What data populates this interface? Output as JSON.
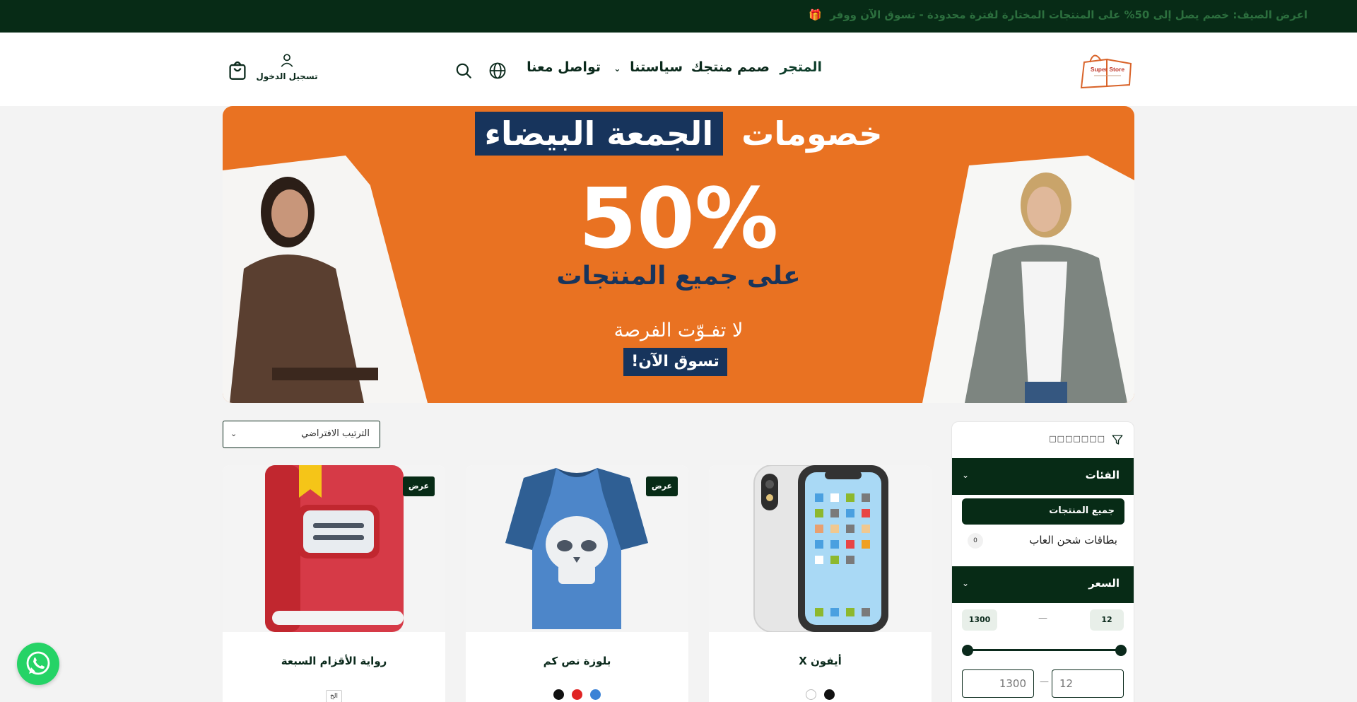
{
  "promo_bar": {
    "text": "اعرض الصيف: خصم يصل إلى 50% على المنتجات المختارة لفترة محدودة - تسوق الآن ووفر",
    "gift_icon": "🎁"
  },
  "header": {
    "logo_text": "Super Store",
    "nav": {
      "store": "المتجر",
      "design": "صمم منتجك",
      "policies": "سياستنا",
      "contact": "تواصل معنا"
    },
    "account_label": "تسجيل الدخول",
    "icons": [
      "globe-icon",
      "search-icon",
      "user-icon",
      "shopping-bag-icon"
    ]
  },
  "banner": {
    "title_plain": "خصومات",
    "title_highlight": "الجمعة البيضاء",
    "percent": "50%",
    "subtitle": "على جميع المنتجات",
    "dont_miss": "لا تفـوّت الفرصة",
    "cta": "تسوق الآن!"
  },
  "sort": {
    "selected": "الترتيب الافتراضي"
  },
  "filters": {
    "title": "□□□□□□□",
    "categories_title": "الفئات",
    "all_products": "جميع المنتجات",
    "category_items": [
      {
        "name": "بطاقات شحن العاب",
        "count": "0"
      }
    ],
    "price_title": "السعر",
    "price_min": "12",
    "price_max": "1300",
    "dash": "—"
  },
  "products": [
    {
      "name": "أيفون X",
      "badge": "",
      "colors": [
        "#111111",
        "#ffffff"
      ],
      "size": ""
    },
    {
      "name": "بلوزة نص كم",
      "badge": "عرض",
      "colors": [
        "#111111",
        "#e02424",
        "#3b82d6"
      ],
      "size": ""
    },
    {
      "name": "رواية الأقزام السبعة",
      "badge": "عرض",
      "colors": [],
      "size": "الخ"
    }
  ],
  "colors": {
    "dark_green": "#072b16",
    "banner_orange": "#e97222",
    "banner_navy": "#17345c",
    "whatsapp_green": "#25d366"
  }
}
